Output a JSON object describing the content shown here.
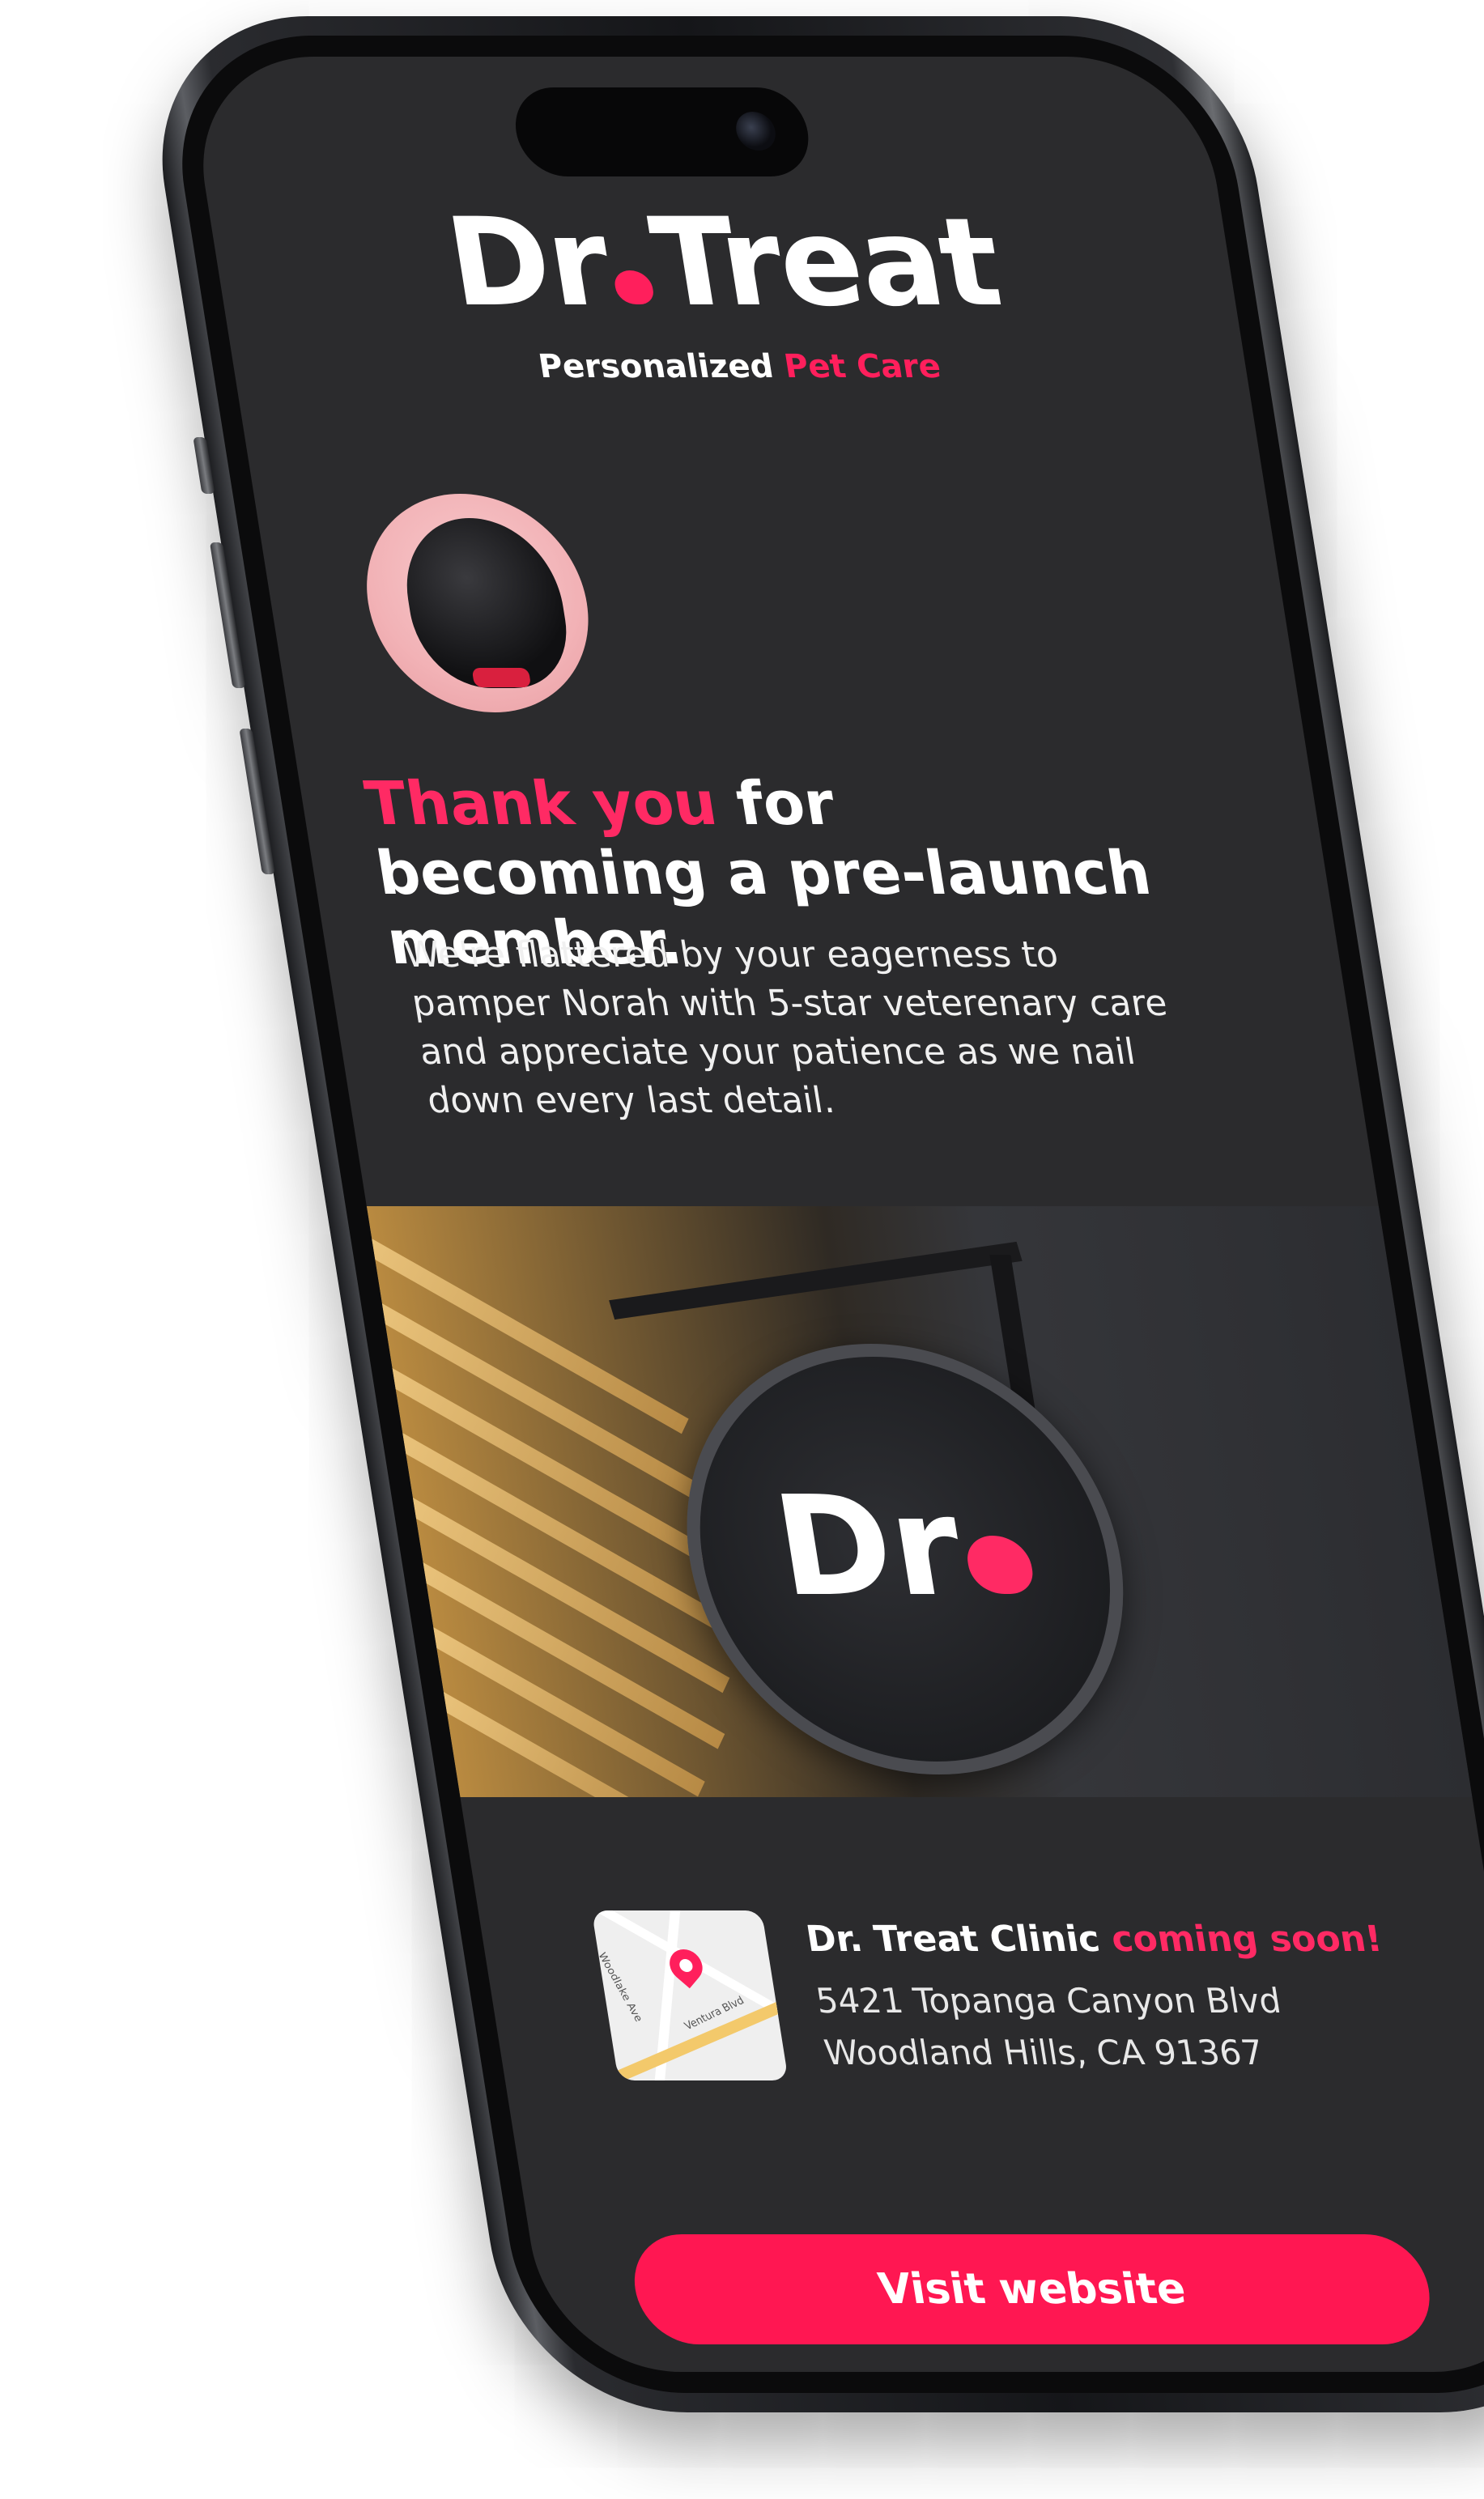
{
  "brand": {
    "logo_text_left": "Dr",
    "logo_text_right": "Treat",
    "tagline_plain": "Personalized",
    "tagline_accent": "Pet Care",
    "accent_color": "#ff1f5c"
  },
  "headline": {
    "accent": "Thank you",
    "rest": " for becoming a pre-launch member."
  },
  "body": {
    "text": "We're flattered by your eagerness to pamper Norah with 5-star veterenary care and appreciate your patience as we nail down every last detail."
  },
  "photo": {
    "sign_text": "Dr"
  },
  "clinic": {
    "title_plain": "Dr. Treat Clinic",
    "title_accent": " coming soon!",
    "address_line1": "5421 Topanga Canyon Blvd",
    "address_line2": "Woodland Hills, CA 91367",
    "map_label_street1": "Woodlake Ave",
    "map_label_street2": "Ventura Blvd"
  },
  "cta": {
    "label": "Visit website"
  },
  "icons": {
    "map_pin": "map-pin-icon",
    "avatar": "pet-avatar"
  }
}
